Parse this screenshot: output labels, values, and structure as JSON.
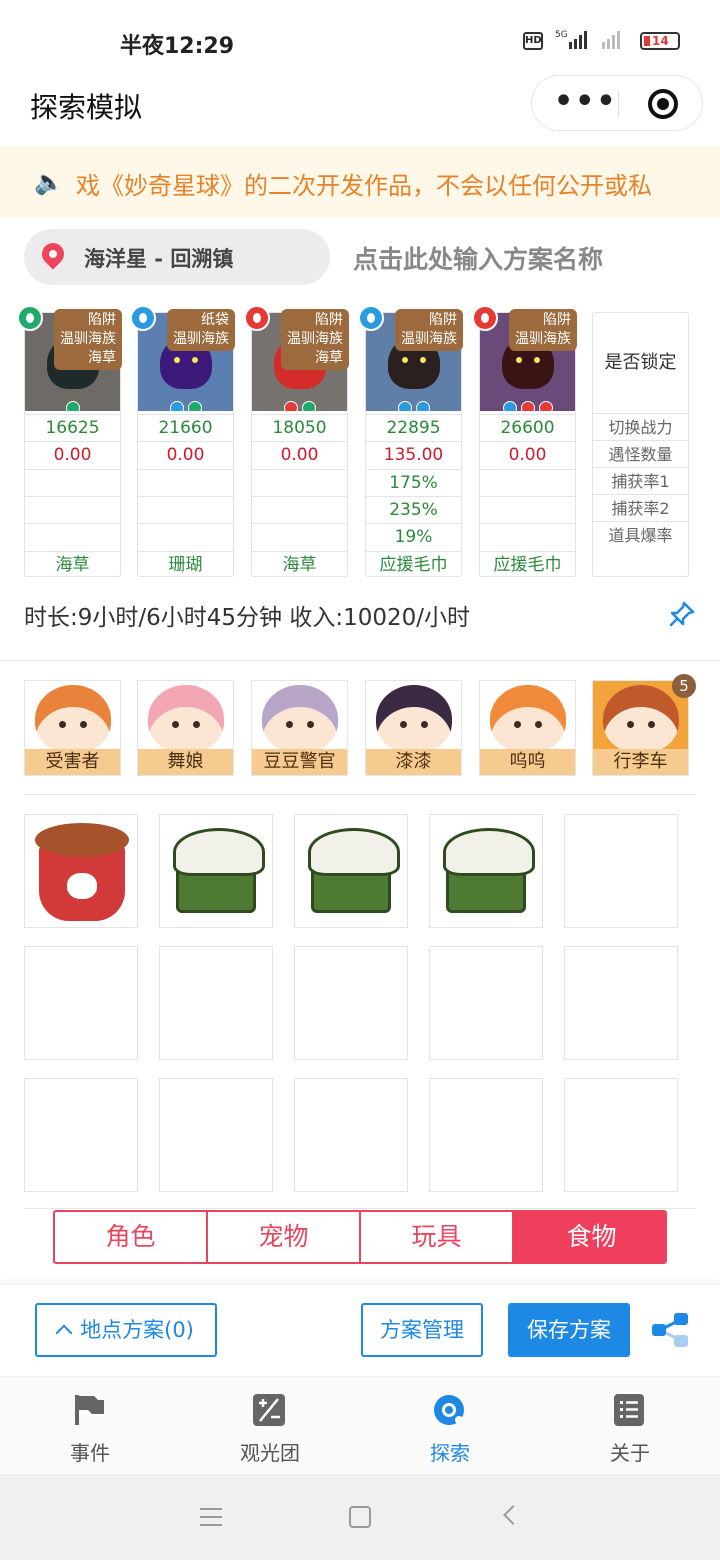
{
  "status": {
    "time": "半夜12:29",
    "hd": "HD",
    "battery": "14"
  },
  "header": {
    "title": "探索模拟"
  },
  "notice": {
    "text": "戏《妙奇星球》的二次开发作品，不会以任何公开或私"
  },
  "location": {
    "name": "海洋星 - 回溯镇",
    "plan_placeholder": "点击此处输入方案名称"
  },
  "pets": [
    {
      "tag_lines": [
        "陷阱",
        "温驯海族",
        "海草"
      ],
      "elem_color": "#1faa6b",
      "body_color": "#1e2b2a",
      "bg": "#6e6a66",
      "minis": [
        "#1faa6b"
      ],
      "power": "16625",
      "encounter": "0.00",
      "rate1": "",
      "rate2": "",
      "drop": "",
      "item": "海草"
    },
    {
      "tag_lines": [
        "纸袋",
        "温驯海族"
      ],
      "elem_color": "#2a9be0",
      "body_color": "#3d1a7a",
      "bg": "#5a7fb0",
      "minis": [
        "#2a9be0",
        "#1faa6b"
      ],
      "power": "21660",
      "encounter": "0.00",
      "rate1": "",
      "rate2": "",
      "drop": "",
      "item": "珊瑚"
    },
    {
      "tag_lines": [
        "陷阱",
        "温驯海族",
        "海草"
      ],
      "elem_color": "#e53935",
      "body_color": "#d42b2b",
      "bg": "#77726d",
      "minis": [
        "#e53935",
        "#1faa6b"
      ],
      "power": "18050",
      "encounter": "0.00",
      "rate1": "",
      "rate2": "",
      "drop": "",
      "item": "海草"
    },
    {
      "tag_lines": [
        "陷阱",
        "温驯海族"
      ],
      "elem_color": "#2a9be0",
      "body_color": "#2a2020",
      "bg": "#5f7fa8",
      "minis": [
        "#2a9be0",
        "#2a9be0"
      ],
      "power": "22895",
      "encounter": "135.00",
      "rate1": "175%",
      "rate2": "235%",
      "drop": "19%",
      "item": "应援毛巾"
    },
    {
      "tag_lines": [
        "陷阱",
        "温驯海族"
      ],
      "elem_color": "#e53935",
      "body_color": "#3a1414",
      "bg": "#6a4a78",
      "minis": [
        "#2a9be0",
        "#e53935",
        "#e53935"
      ],
      "power": "26600",
      "encounter": "0.00",
      "rate1": "",
      "rate2": "",
      "drop": "",
      "item": "应援毛巾"
    }
  ],
  "labels": {
    "lock": "是否锁定",
    "power": "切换战力",
    "encounter": "遇怪数量",
    "rate1": "捕获率1",
    "rate2": "捕获率2",
    "drop": "道具爆率"
  },
  "summary": "时长:9小时/6小时45分钟 收入:10020/小时",
  "characters": [
    {
      "name": "受害者",
      "hair": "#e9823a"
    },
    {
      "name": "舞娘",
      "hair": "#f3a7b5"
    },
    {
      "name": "豆豆警官",
      "hair": "#b8a6c9"
    },
    {
      "name": "漆漆",
      "hair": "#3b2a44"
    },
    {
      "name": "呜呜",
      "hair": "#f08a3a"
    },
    {
      "name": "行李车",
      "hair": "#c05a2a"
    }
  ],
  "character_badge": "5",
  "tabs": [
    "角色",
    "宠物",
    "玩具",
    "食物"
  ],
  "active_tab": "食物",
  "actions": {
    "location_plans": "地点方案(0)",
    "manage": "方案管理",
    "save": "保存方案"
  },
  "tabbar": [
    {
      "label": "事件",
      "icon": "flag-icon"
    },
    {
      "label": "观光团",
      "icon": "calculator-icon"
    },
    {
      "label": "探索",
      "icon": "planet-icon"
    },
    {
      "label": "关于",
      "icon": "list-icon"
    }
  ],
  "tabbar_active": "探索"
}
